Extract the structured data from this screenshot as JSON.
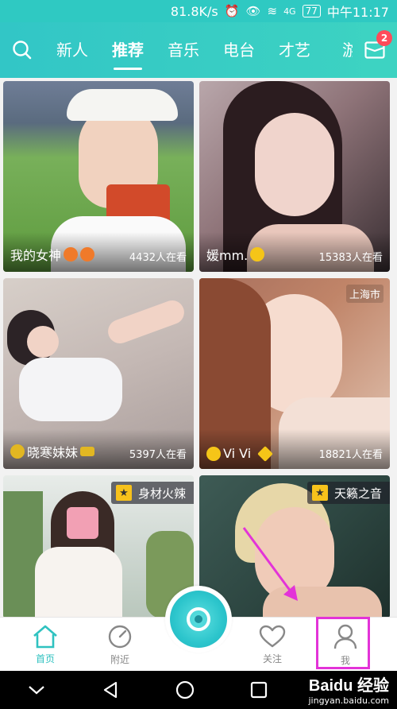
{
  "status_bar": {
    "speed": "81.8K/s",
    "network": "4G",
    "battery": "77",
    "time": "中午11:17"
  },
  "top_nav": {
    "tabs": [
      {
        "label": "新人"
      },
      {
        "label": "推荐"
      },
      {
        "label": "音乐"
      },
      {
        "label": "电台"
      },
      {
        "label": "才艺"
      },
      {
        "label": "游"
      }
    ],
    "active_tab": "推荐",
    "mail_badge": "2"
  },
  "cards": [
    {
      "name": "我的女神",
      "viewers": "4432人在看"
    },
    {
      "name": "媛mm.",
      "viewers": "15383人在看"
    },
    {
      "name": "晓寒妹妹",
      "viewers": "5397人在看"
    },
    {
      "name": "Vi Vi",
      "viewers": "18821人在看",
      "location": "上海市"
    },
    {
      "tag": "身材火辣"
    },
    {
      "tag": "天籁之音"
    }
  ],
  "bottom_nav": {
    "items": [
      {
        "label": "首页"
      },
      {
        "label": "附近"
      },
      {
        "label": "关注"
      },
      {
        "label": "我"
      }
    ]
  },
  "watermark": {
    "line1": "Baidu 经验",
    "line2": "jingyan.baidu.com"
  },
  "colors": {
    "accent": "#2fc9c2",
    "badge": "#ff4b5a",
    "highlight": "#e333d8"
  }
}
